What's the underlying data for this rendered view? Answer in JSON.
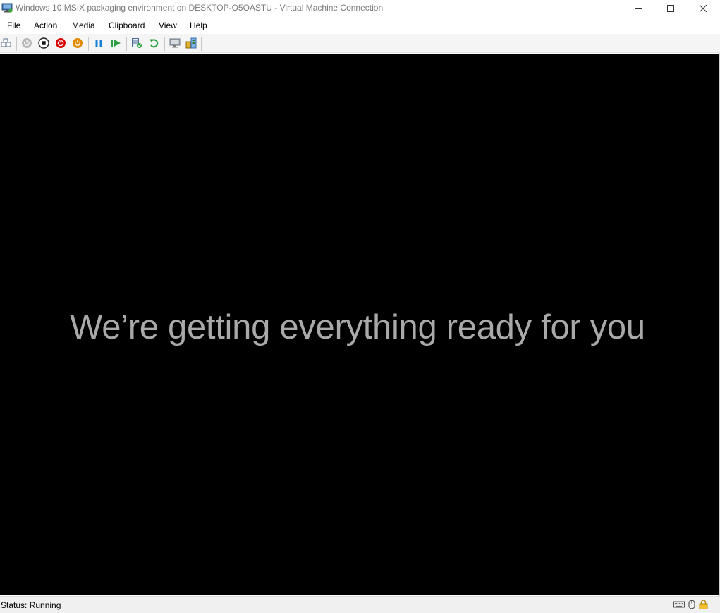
{
  "window": {
    "title": "Windows 10 MSIX packaging environment on DESKTOP-O5OASTU - Virtual Machine Connection"
  },
  "menu": {
    "items": [
      "File",
      "Action",
      "Media",
      "Clipboard",
      "View",
      "Help"
    ]
  },
  "toolbar": {
    "buttons": [
      {
        "name": "ctrl-alt-del-icon"
      },
      {
        "name": "start-icon"
      },
      {
        "name": "turn-off-icon"
      },
      {
        "name": "shut-down-icon"
      },
      {
        "name": "save-icon"
      },
      {
        "name": "pause-icon"
      },
      {
        "name": "reset-icon"
      },
      {
        "name": "checkpoint-icon"
      },
      {
        "name": "revert-icon"
      },
      {
        "name": "enhanced-session-icon"
      },
      {
        "name": "share-icon"
      }
    ]
  },
  "screen": {
    "message": "We’re getting everything ready for you"
  },
  "status": {
    "text": "Status: Running"
  },
  "colors": {
    "screen_bg": "#000000",
    "message": "#a9a9a9",
    "stop_red": "#d80000",
    "save_orange": "#e08a00",
    "pause_blue": "#1c7fd6",
    "reset_green": "#2ea043"
  }
}
